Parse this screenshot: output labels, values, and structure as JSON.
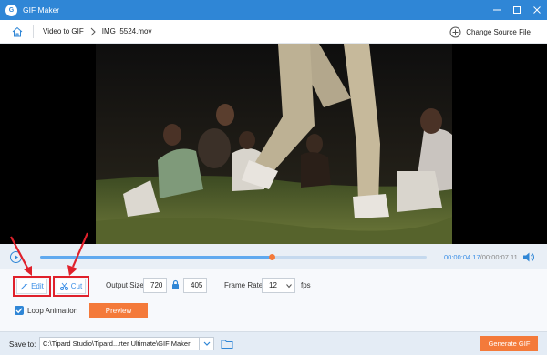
{
  "window": {
    "logo_letter": "G",
    "title": "GIF Maker",
    "controls": [
      "minimize-icon",
      "maximize-icon",
      "close-icon"
    ]
  },
  "nav": {
    "home_icon": "home-icon",
    "breadcrumb": [
      "Video to GIF",
      "IMG_5524.mov"
    ],
    "change_source_label": "Change Source File",
    "change_source_icon": "plus-circle-icon"
  },
  "player": {
    "current_time": "00:00:04.17",
    "total_time": "00:00:07.11",
    "progress": 0.6
  },
  "tools": {
    "edit_label": "Edit",
    "cut_label": "Cut",
    "edit_icon": "magic-wand-icon",
    "cut_icon": "scissors-icon"
  },
  "output": {
    "size_label": "Output Size:",
    "width": "720",
    "height": "405",
    "lock_icon": "lock-icon",
    "frame_rate_label": "Frame Rate:",
    "frame_rate": "12",
    "fps_label": "fps"
  },
  "loop": {
    "label": "Loop Animation",
    "checked": true
  },
  "preview_label": "Preview",
  "save": {
    "label": "Save to:",
    "path": "C:\\Tipard Studio\\Tipard...rter Ultimate\\GIF Maker",
    "folder_icon": "folder-icon"
  },
  "generate_label": "Generate GIF",
  "colors": {
    "accent": "#2f86d6",
    "orange": "#f47a3a",
    "highlight": "#e0212b"
  }
}
